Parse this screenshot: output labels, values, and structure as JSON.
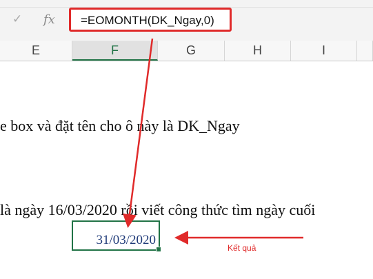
{
  "formula_bar": {
    "cancel_icon": "check-icon",
    "fx_label": "fx",
    "formula": "=EOMONTH(DK_Ngay,0)"
  },
  "columns": [
    "E",
    "F",
    "G",
    "H",
    "I"
  ],
  "selected_column": "F",
  "sheet": {
    "line1": "e box và đặt tên cho ô này là DK_Ngay",
    "line2": "là ngày 16/03/2020 rồi viết công thức tìm ngày cuối",
    "selected_cell_value": "31/03/2020"
  },
  "annotation": {
    "label": "Kết quả",
    "color": "#e02a2a"
  }
}
